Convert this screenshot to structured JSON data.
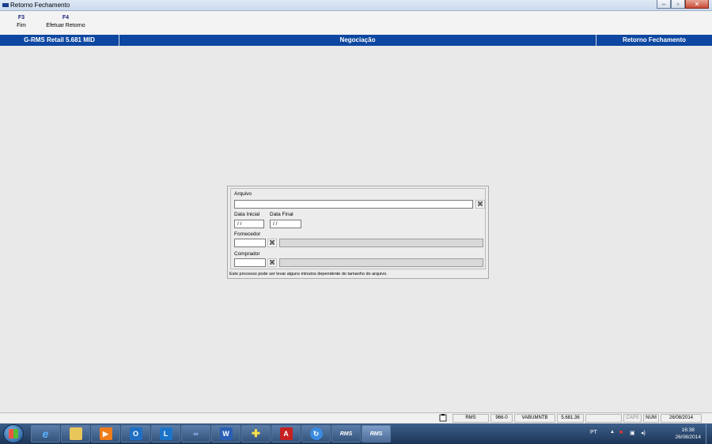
{
  "window": {
    "title": "Retorno Fechamento"
  },
  "toolbar": {
    "fkeys": [
      {
        "key": "F3",
        "label": "Fim"
      },
      {
        "key": "F4",
        "label": "Efetuar Retorno"
      }
    ]
  },
  "header_bar": {
    "left": "G-RMS Retail 5.681 MID",
    "center": "Negociação",
    "right": "Retorno Fechamento"
  },
  "form": {
    "arquivo": {
      "label": "Arquivo",
      "value": ""
    },
    "data_inicial": {
      "label": "Data Inicial",
      "value": " / /"
    },
    "data_final": {
      "label": "Data Final",
      "value": " / /"
    },
    "fornecedor": {
      "label": "Fornecedor",
      "code": "",
      "name": ""
    },
    "comprador": {
      "label": "Comprador",
      "code": "",
      "name": ""
    },
    "note": "Este processo pode ser levar alguns minutos dependente do tamanho do arquivo."
  },
  "statusbar": {
    "cells": [
      "RMS",
      "966-0",
      "VABUMNTB",
      "5.681.36",
      "",
      "CAPS",
      "NUM",
      "26/08/2014"
    ]
  },
  "taskbar": {
    "apps": [
      "internet-explorer",
      "file-explorer",
      "media-player",
      "outlook",
      "lync",
      "skype",
      "word",
      "app-plus",
      "acrobat",
      "ie-arrow",
      "RMS",
      "RMS"
    ],
    "tray": {
      "lang": "PT",
      "time": "16:38",
      "date": "26/08/2014"
    }
  },
  "colors": {
    "header_blue": "#0d47a1",
    "fkey_blue": "#1a237e"
  }
}
